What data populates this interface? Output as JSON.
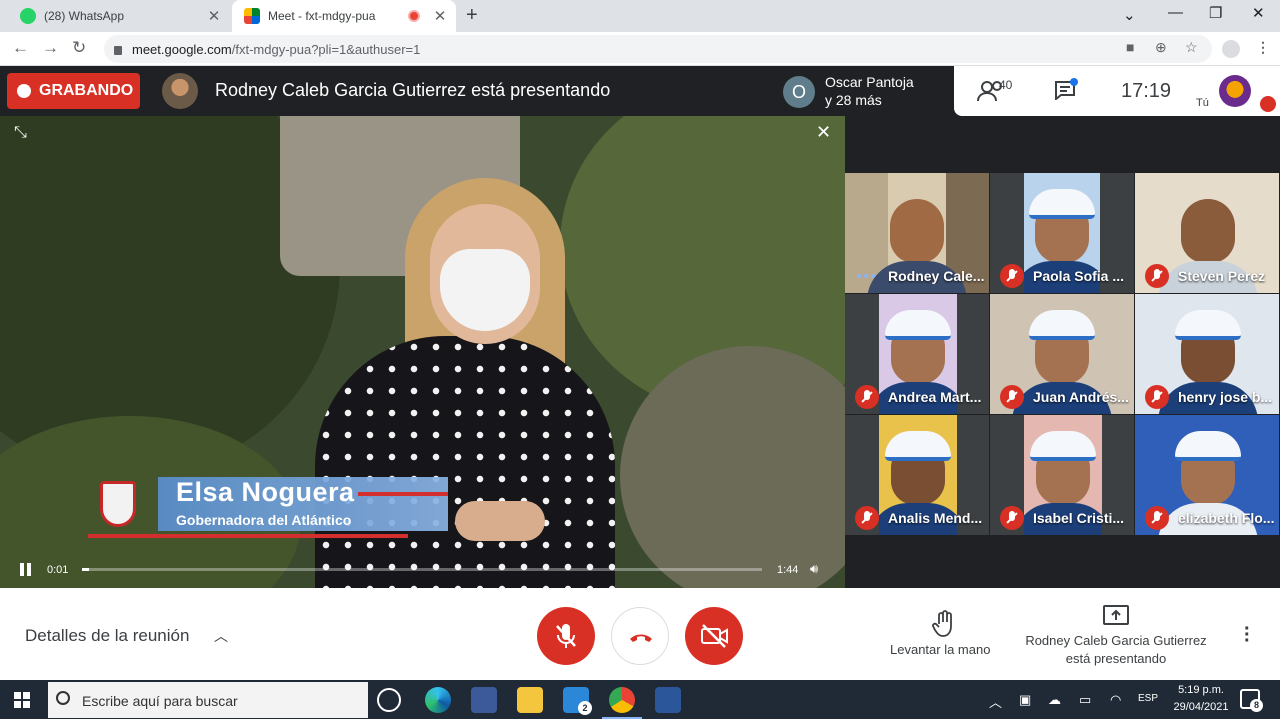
{
  "browser": {
    "tabs": [
      {
        "title": "(28) WhatsApp",
        "active": false
      },
      {
        "title": "Meet - fxt-mdgy-pua",
        "active": true,
        "recording": true
      }
    ],
    "new_tab_icon": "plus-icon",
    "window_controls": [
      "tab-search-icon",
      "minimize-icon",
      "maximize-icon",
      "close-icon"
    ],
    "url_host": "meet.google.com",
    "url_path": "/fxt-mdgy-pua?pli=1&authuser=1"
  },
  "meet_header": {
    "recording_label": "GRABANDO",
    "presenting_title": "Rodney Caleb Garcia Gutierrez está presentando",
    "others_avatar_initial": "O",
    "others_name": "Oscar Pantoja",
    "others_more": "y 28 más",
    "people_count": "40",
    "clock": "17:19",
    "self_label": "Tú"
  },
  "video": {
    "lower_third_name": "Elsa Noguera",
    "lower_third_title": "Gobernadora del Atlántico",
    "current_time": "0:01",
    "total_time": "1:44",
    "progress": 0.01
  },
  "participants": [
    {
      "name": "Rodney Cale...",
      "speaking": true
    },
    {
      "name": "Paola Sofia ...",
      "muted": true
    },
    {
      "name": "Steven Perez",
      "muted": true
    },
    {
      "name": "Andrea Mart...",
      "muted": true
    },
    {
      "name": "Juan Andrés...",
      "muted": true
    },
    {
      "name": "henry jose b...",
      "muted": true
    },
    {
      "name": "Analis Mend...",
      "muted": true
    },
    {
      "name": "Isabel Cristi...",
      "muted": true
    },
    {
      "name": "elizabeth Flo...",
      "muted": true
    }
  ],
  "bottom_bar": {
    "details_label": "Detalles de la reunión",
    "raise_hand_label": "Levantar la mano",
    "presenting_line1": "Rodney Caleb Garcia Gutierrez",
    "presenting_line2": "está presentando"
  },
  "taskbar": {
    "search_placeholder": "Escribe aquí para buscar",
    "mail_badge": "2",
    "language": "ESP",
    "time": "5:19 p.m.",
    "date": "29/04/2021",
    "notification_count": "8"
  },
  "colors": {
    "meet_red": "#d93025",
    "meet_dark": "#202124",
    "taskbar": "#1f2a36",
    "accent_blue": "#1a73e8"
  }
}
